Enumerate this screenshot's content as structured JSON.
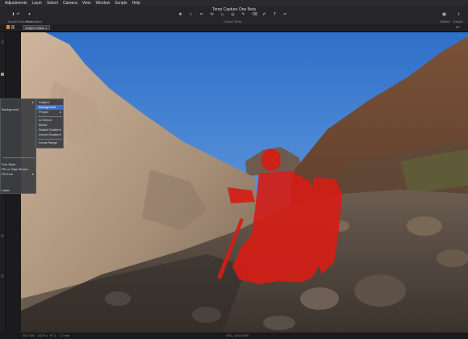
{
  "menubar": {
    "items": [
      "Adjustments",
      "Layer",
      "Select",
      "Camera",
      "View",
      "Window",
      "Scripts",
      "Help"
    ]
  },
  "toolbar": {
    "title": "Temp Capture One Beta",
    "left_labels": [
      "Import",
      "Undo/Redo",
      "Auto adjust"
    ],
    "center_label": "Cursor Tools",
    "right_labels": [
      "Before",
      "Export"
    ]
  },
  "strip": {
    "layer_select": "Subject Mask 1",
    "right_text": "Fit"
  },
  "context_menu": {
    "items": [
      "",
      "Background",
      "",
      "Sub Style...",
      "Fill on Style Brush...",
      "Fill from",
      "",
      "Layer"
    ],
    "submenu": {
      "items": [
        "Subject",
        "Background",
        "People",
        "AI Select",
        "Brush",
        "Radial Gradient",
        "Linear Gradient",
        "Luma Range"
      ],
      "highlighted": "Background"
    }
  },
  "status": {
    "iso": "ISO 100",
    "shutter": "1/125 s",
    "aperture": "f/7.1",
    "focal": "17 mm",
    "filename": "DSC_0218.NEF"
  }
}
